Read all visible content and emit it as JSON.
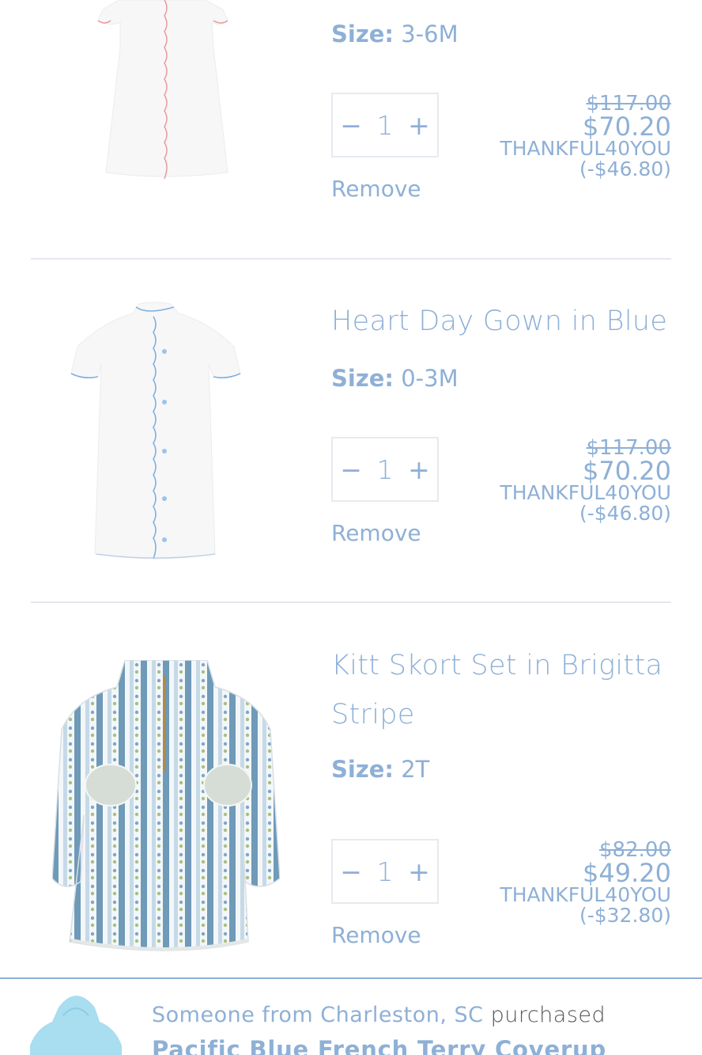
{
  "cart": {
    "items": [
      {
        "title": "",
        "size_label": "Size:",
        "size_value": "3-6M",
        "quantity": "1",
        "decrement": "−",
        "increment": "+",
        "remove_label": "Remove",
        "original_price": "$117.00",
        "sale_price": "$70.20",
        "discount": "THANKFUL40YOU (-$46.80)",
        "trim_color": "#e79b9b"
      },
      {
        "title": "Heart Day Gown in Blue",
        "size_label": "Size:",
        "size_value": "0-3M",
        "quantity": "1",
        "decrement": "−",
        "increment": "+",
        "remove_label": "Remove",
        "original_price": "$117.00",
        "sale_price": "$70.20",
        "discount": "THANKFUL40YOU (-$46.80)",
        "trim_color": "#7fb0e0"
      },
      {
        "title": "Kitt Skort Set in Brigitta Stripe",
        "size_label": "Size:",
        "size_value": "2T",
        "quantity": "1",
        "decrement": "−",
        "increment": "+",
        "remove_label": "Remove",
        "original_price": "$82.00",
        "sale_price": "$49.20",
        "discount": "THANKFUL40YOU (-$32.80)",
        "trim_color": "#6c96bd"
      }
    ]
  },
  "notification": {
    "location_text": "Someone from Charleston, SC",
    "purchased": "purchased",
    "product": "Pacific Blue French Terry Coverup"
  },
  "colors": {
    "text": "#8eb0d6",
    "divider": "#e4e8ee",
    "notify_border": "#8eb0d6"
  }
}
